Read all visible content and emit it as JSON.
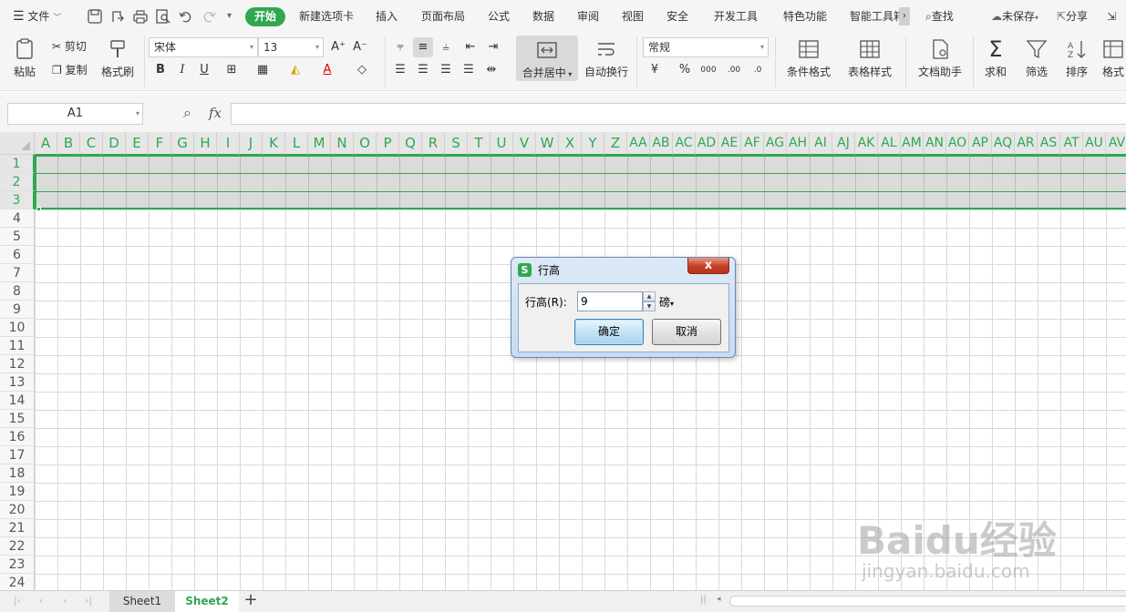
{
  "menubar": {
    "file_label": "文件",
    "active_tab": "开始",
    "tabs": [
      "新建选项卡",
      "插入",
      "页面布局",
      "公式",
      "数据",
      "审阅",
      "视图",
      "安全",
      "开发工具",
      "特色功能",
      "智能工具箱"
    ],
    "search_label": "查找",
    "unsaved_label": "未保存",
    "share_label": "分享"
  },
  "ribbon": {
    "paste_label": "粘贴",
    "cut_label": "剪切",
    "copy_label": "复制",
    "format_painter_label": "格式刷",
    "font_name": "宋体",
    "font_size": "13",
    "merge_label": "合并居中",
    "wrap_label": "自动换行",
    "number_format": "常规",
    "cond_format_label": "条件格式",
    "table_style_label": "表格样式",
    "doc_helper_label": "文档助手",
    "sum_label": "求和",
    "filter_label": "筛选",
    "sort_label": "排序",
    "format_label": "格式"
  },
  "formula_bar": {
    "name_box": "A1",
    "fx": "fx",
    "value": ""
  },
  "grid": {
    "columns": [
      "A",
      "B",
      "C",
      "D",
      "E",
      "F",
      "G",
      "H",
      "I",
      "J",
      "K",
      "L",
      "M",
      "N",
      "O",
      "P",
      "Q",
      "R",
      "S",
      "T",
      "U",
      "V",
      "W",
      "X",
      "Y",
      "Z",
      "AA",
      "AB",
      "AC",
      "AD",
      "AE",
      "AF",
      "AG",
      "AH",
      "AI",
      "AJ",
      "AK",
      "AL",
      "AM",
      "AN",
      "AO",
      "AP",
      "AQ",
      "AR",
      "AS",
      "AT",
      "AU",
      "AV"
    ],
    "rows": [
      "1",
      "2",
      "3",
      "4",
      "5",
      "6",
      "7",
      "8",
      "9",
      "10",
      "11",
      "12",
      "13",
      "14",
      "15",
      "16",
      "17",
      "18",
      "19",
      "20",
      "21",
      "22",
      "23",
      "24"
    ],
    "selected_rows": [
      "1",
      "2",
      "3"
    ]
  },
  "dialog": {
    "title": "行高",
    "row_height_label": "行高(R):",
    "row_height_value": "9",
    "unit_label": "磅",
    "ok_label": "确定",
    "cancel_label": "取消",
    "close_glyph": "x"
  },
  "sheets": {
    "tabs": [
      "Sheet1",
      "Sheet2"
    ],
    "active": "Sheet2"
  },
  "watermark": {
    "brand": "Baidu经验",
    "url": "jingyan.baidu.com"
  },
  "colors": {
    "accent_green": "#2fa84f",
    "dialog_blue": "#c7dbf2",
    "close_red": "#c9432a"
  }
}
